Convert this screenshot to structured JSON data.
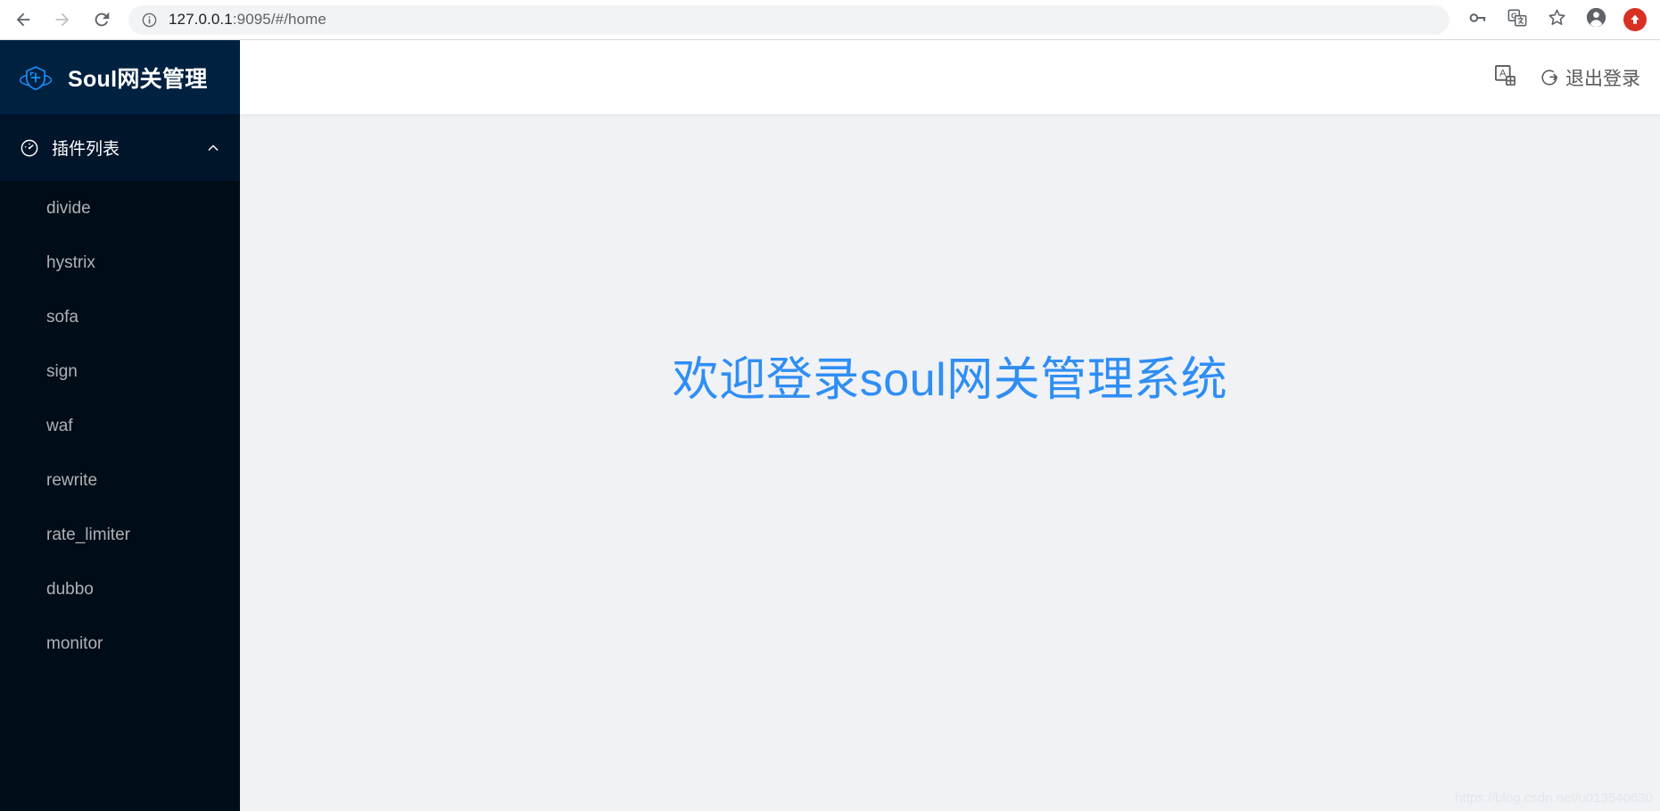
{
  "browser": {
    "back_label": "Back",
    "forward_label": "Forward",
    "reload_label": "Reload",
    "url_host": "127.0.0.1",
    "url_rest": ":9095/#/home",
    "url_full": "127.0.0.1:9095/#/home",
    "icons": {
      "info": "site-information-icon",
      "back": "back-arrow-icon",
      "forward": "forward-arrow-icon",
      "reload": "reload-icon",
      "password": "key-icon",
      "translate": "google-translate-icon",
      "bookmark": "star-icon",
      "profile": "profile-avatar-icon",
      "update": "update-arrow-icon"
    }
  },
  "sidebar": {
    "logo_icon": "soul-shield-logo",
    "title": "Soul网关管理",
    "group": {
      "icon": "dashboard-icon",
      "label": "插件列表",
      "arrow": "chevron-up-icon",
      "expanded": true
    },
    "items": [
      {
        "label": "divide"
      },
      {
        "label": "hystrix"
      },
      {
        "label": "sofa"
      },
      {
        "label": "sign"
      },
      {
        "label": "waf"
      },
      {
        "label": "rewrite"
      },
      {
        "label": "rate_limiter"
      },
      {
        "label": "dubbo"
      },
      {
        "label": "monitor"
      }
    ]
  },
  "topbar": {
    "language_icon": "language-switch-icon",
    "logout_icon": "logout-icon",
    "logout_label": "退出登录"
  },
  "content": {
    "welcome_text": "欢迎登录soul网关管理系统",
    "watermark": "https://blog.csdn.net/u013540630"
  },
  "colors": {
    "sidebar_bg": "#001529",
    "sidebar_logo_bg": "#002140",
    "submenu_bg": "#000c17",
    "accent": "#1890ff",
    "welcome_blue": "#2f8ef4",
    "content_bg": "#f0f2f5",
    "update_red": "#d93025"
  }
}
